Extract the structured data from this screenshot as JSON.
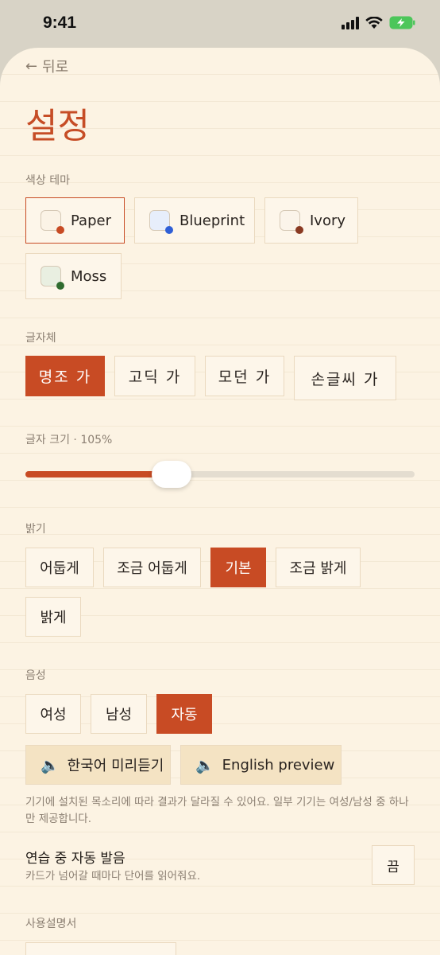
{
  "status": {
    "time": "9:41"
  },
  "nav": {
    "back_label": "뒤로",
    "back_icon": "arrow-left-icon"
  },
  "title": "설정",
  "theme": {
    "label": "색상 테마",
    "options": [
      {
        "name": "Paper",
        "bg": "#fbf3e6",
        "dot": "#c84b24",
        "selected": true
      },
      {
        "name": "Blueprint",
        "bg": "#e7eefb",
        "dot": "#2f5fd6",
        "selected": false
      },
      {
        "name": "Ivory",
        "bg": "#fbf4ea",
        "dot": "#8a3a22",
        "selected": false
      },
      {
        "name": "Moss",
        "bg": "#e9efe1",
        "dot": "#2f6b2f",
        "selected": false
      }
    ]
  },
  "font": {
    "label": "글자체",
    "options": [
      {
        "name": "명조 가",
        "selected": true
      },
      {
        "name": "고딕 가",
        "selected": false
      },
      {
        "name": "모던 가",
        "selected": false
      },
      {
        "name": "손글씨 가",
        "selected": false
      }
    ]
  },
  "size": {
    "label": "글자 크기 · 105%",
    "value": 0.36
  },
  "brightness": {
    "label": "밝기",
    "options": [
      {
        "name": "어둡게",
        "selected": false
      },
      {
        "name": "조금 어둡게",
        "selected": false
      },
      {
        "name": "기본",
        "selected": true
      },
      {
        "name": "조금 밝게",
        "selected": false
      },
      {
        "name": "밝게",
        "selected": false
      }
    ]
  },
  "voice": {
    "label": "음성",
    "options": [
      {
        "name": "여성",
        "selected": false
      },
      {
        "name": "남성",
        "selected": false
      },
      {
        "name": "자동",
        "selected": true
      }
    ],
    "preview_ko": "한국어 미리듣기",
    "preview_en": "English preview",
    "help": "기기에 설치된 목소리에 따라 결과가 달라질 수 있어요. 일부 기기는 여성/남성 중 하나만 제공합니다."
  },
  "auto_pronounce": {
    "title": "연습 중 자동 발음",
    "subtitle": "카드가 넘어갈 때마다 단어를 읽어줘요.",
    "toggle": "끔"
  },
  "manual": {
    "label": "사용설명서"
  },
  "colors": {
    "accent": "#c84b24",
    "background": "#fcf3e3"
  }
}
